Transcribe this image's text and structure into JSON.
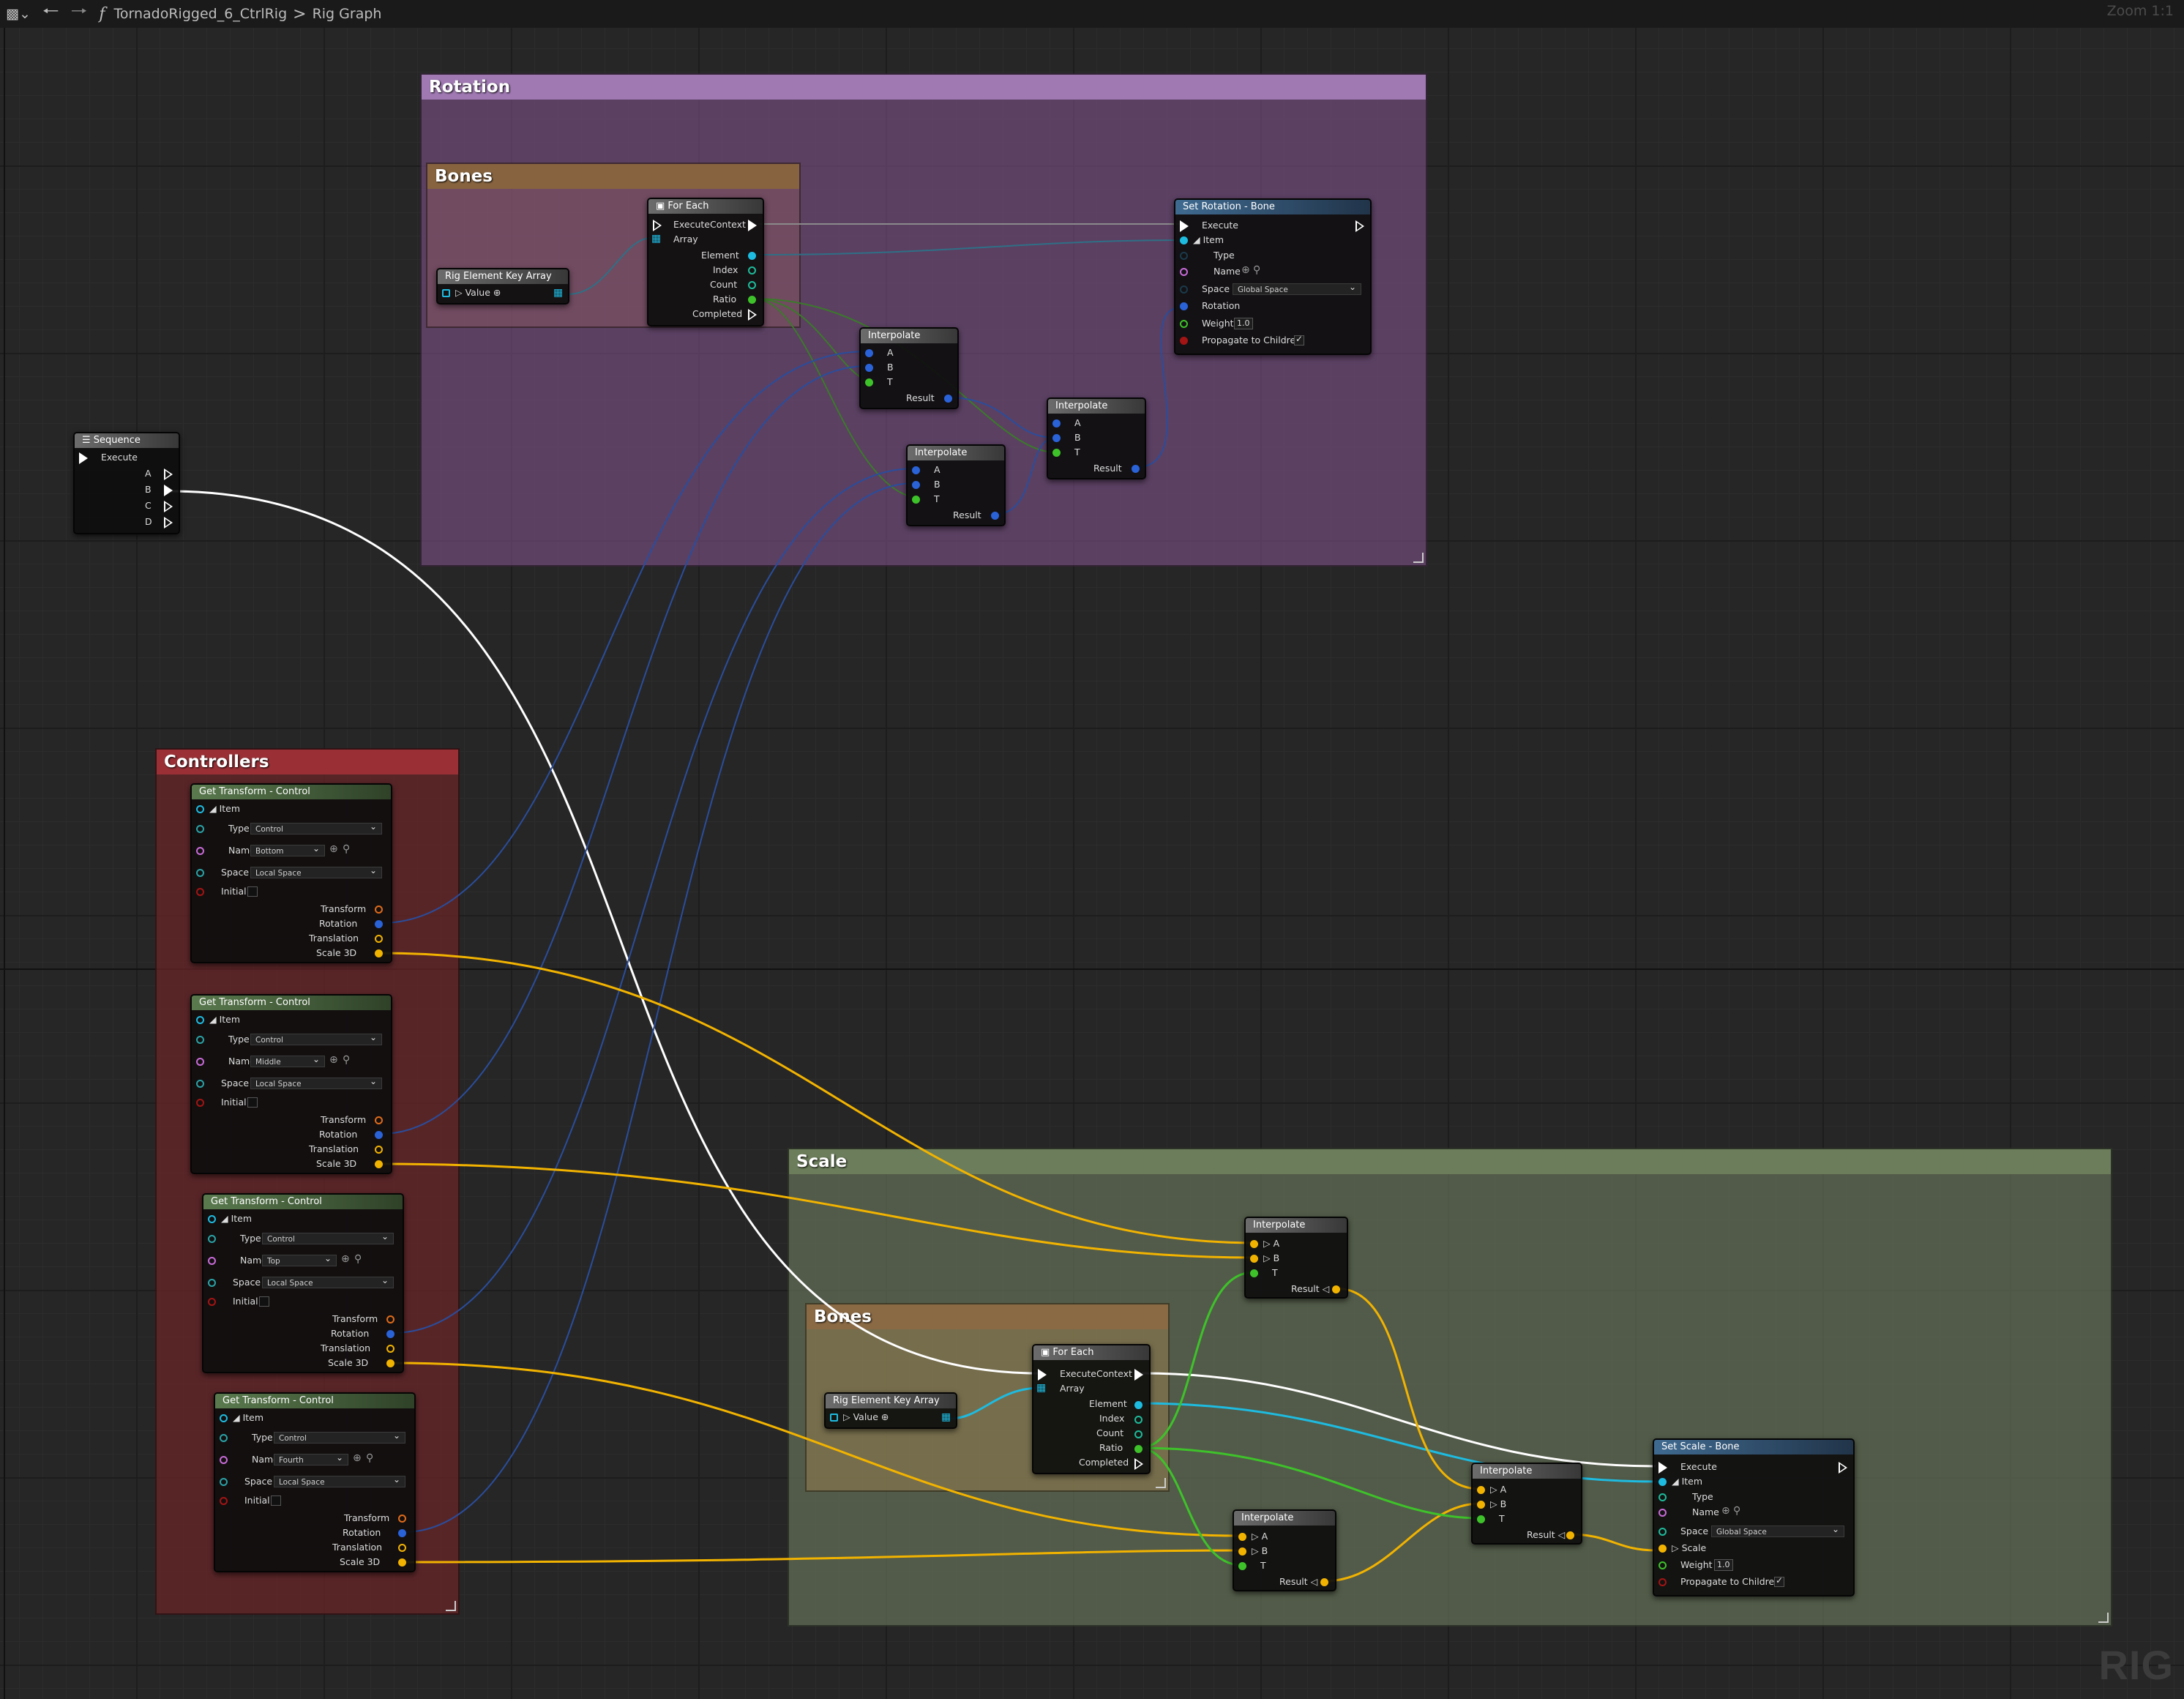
{
  "toolbar": {
    "breadcrumb_graph": "TornadoRigged_6_CtrlRig",
    "breadcrumb_sep": ">",
    "breadcrumb_current": "Rig Graph",
    "zoom_label": "Zoom 1:1",
    "function_icon": "f"
  },
  "watermark": "RIG",
  "comments": {
    "rotation": "Rotation",
    "rotation_bones": "Bones",
    "controllers": "Controllers",
    "scale": "Scale",
    "scale_bones": "Bones"
  },
  "sequence": {
    "title": "Sequence",
    "execute": "Execute",
    "pins": [
      "A",
      "B",
      "C",
      "D"
    ]
  },
  "get_transform": {
    "title": "Get Transform - Control",
    "item": "Item",
    "type_label": "Type",
    "type_value": "Control",
    "name_label": "Name",
    "space_label": "Space",
    "space_value": "Local Space",
    "initial": "Initial",
    "transform": "Transform",
    "rotation": "Rotation",
    "translation": "Translation",
    "scale3d": "Scale 3D",
    "names": [
      "Bottom",
      "Middle",
      "Top",
      "Fourth"
    ]
  },
  "foreach": {
    "title": "For Each",
    "execute_context": "ExecuteContext",
    "array": "Array",
    "element": "Element",
    "index": "Index",
    "count": "Count",
    "ratio": "Ratio",
    "completed": "Completed"
  },
  "key_array": {
    "title": "Rig Element Key Array",
    "value": "Value"
  },
  "interpolate": {
    "title": "Interpolate",
    "a": "A",
    "b": "B",
    "t": "T",
    "result": "Result"
  },
  "set_rotation": {
    "title": "Set Rotation - Bone",
    "execute": "Execute",
    "item": "Item",
    "type": "Type",
    "name": "Name",
    "space": "Space",
    "space_value": "Global Space",
    "rotation": "Rotation",
    "weight": "Weight",
    "weight_value": "1.0",
    "propagate": "Propagate to Children"
  },
  "set_scale": {
    "title": "Set Scale - Bone",
    "execute": "Execute",
    "item": "Item",
    "type": "Type",
    "name": "Name",
    "space": "Space",
    "space_value": "Global Space",
    "scale": "Scale",
    "weight": "Weight",
    "weight_value": "1.0",
    "propagate": "Propagate to Children"
  },
  "colors": {
    "exec": "#ffffff",
    "rotation_wire": "#2a4d9c",
    "scale_wire": "#f2b300",
    "float_wire": "#3ec22a",
    "element_wire": "#1ebbe0",
    "name_pin": "#c86bd8",
    "bool_pin": "#a31414",
    "transform_pin": "#e06b1a"
  }
}
